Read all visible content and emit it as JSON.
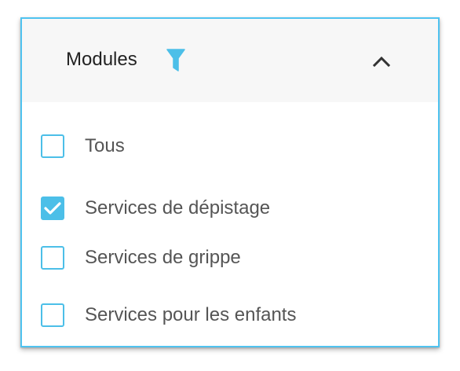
{
  "header": {
    "title": "Modules",
    "filter_icon": "filter-icon",
    "collapse_icon": "chevron-up-icon"
  },
  "options": [
    {
      "label": "Tous",
      "checked": false
    },
    {
      "label": "Services de dépistage",
      "checked": true
    },
    {
      "label": "Services de grippe",
      "checked": false
    },
    {
      "label": "Services pour les enfants",
      "checked": false
    }
  ],
  "colors": {
    "accent": "#4cbfe8",
    "border": "#4fc3f0",
    "header_bg": "#f7f7f7",
    "label_text": "#555555",
    "title_text": "#222222"
  }
}
